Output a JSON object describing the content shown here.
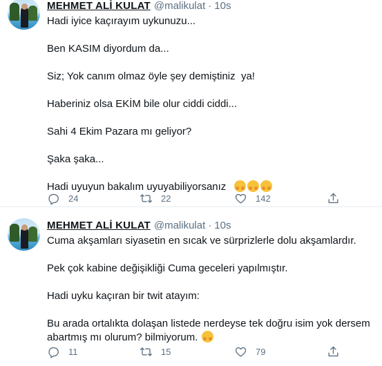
{
  "tweets": [
    {
      "author_name": "MEHMET ALİ KULAT",
      "handle": "@malikulat",
      "separator": "·",
      "time": "10s",
      "paragraphs": [
        "Hadi iyice kaçırayım uykunuzu...",
        "Ben KASIM diyordum da...",
        "Siz; Yok canım olmaz öyle şey demiştiniz  ya!",
        "Haberiniz olsa EKİM bile olur ciddi ciddi...",
        "Sahi 4 Ekim Pazara mı geliyor?",
        "Şaka şaka...",
        "Hadi uyuyun bakalım uyuyabiliyorsanız"
      ],
      "emoji_icon": "hugging-face-icon",
      "reply_count": "24",
      "retweet_count": "22",
      "like_count": "142"
    },
    {
      "author_name": "MEHMET ALİ KULAT",
      "handle": "@malikulat",
      "separator": "·",
      "time": "10s",
      "paragraphs": [
        "Cuma akşamları siyasetin en sıcak ve sürprizlerle dolu akşamlardır.",
        "Pek çok kabine değişikliği Cuma geceleri yapılmıştır.",
        "Hadi uyku kaçıran bir twit atayım:",
        "Bu arada ortalıkta dolaşan listede nerdeyse tek doğru isim yok dersem abartmış mı olurum? bilmiyorum."
      ],
      "emoji_icon": "hugging-face-icon",
      "reply_count": "11",
      "retweet_count": "15",
      "like_count": "79"
    }
  ],
  "colors": {
    "text": "#0f1419",
    "muted": "#5b7083",
    "divider": "#e6ecf0",
    "emoji": "#f7c23a"
  }
}
